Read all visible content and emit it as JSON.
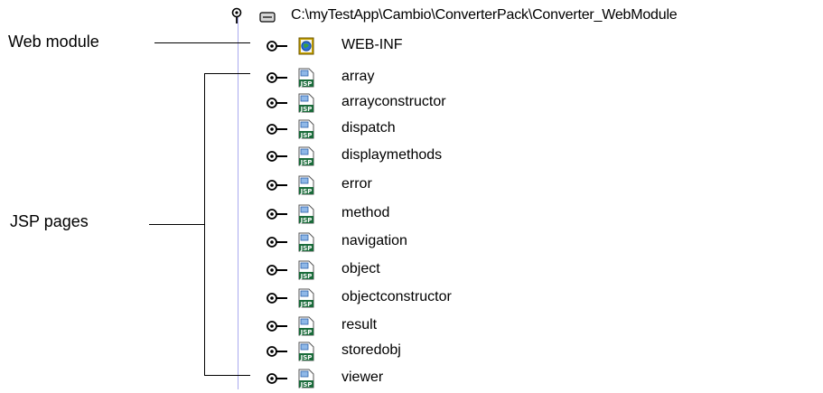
{
  "tree": {
    "root": {
      "path": "C:\\myTestApp\\Cambio\\ConverterPack\\Converter_WebModule",
      "expand_icon": "pin-handle-icon",
      "icon": "drive-icon"
    },
    "nodes": [
      {
        "label": "WEB-INF",
        "icon": "web-module-icon"
      },
      {
        "label": "array",
        "icon": "jsp-file-icon"
      },
      {
        "label": "arrayconstructor",
        "icon": "jsp-file-icon"
      },
      {
        "label": "dispatch",
        "icon": "jsp-file-icon"
      },
      {
        "label": "displaymethods",
        "icon": "jsp-file-icon"
      },
      {
        "label": "error",
        "icon": "jsp-file-icon"
      },
      {
        "label": "method",
        "icon": "jsp-file-icon"
      },
      {
        "label": "navigation",
        "icon": "jsp-file-icon"
      },
      {
        "label": "object",
        "icon": "jsp-file-icon"
      },
      {
        "label": "objectconstructor",
        "icon": "jsp-file-icon"
      },
      {
        "label": "result",
        "icon": "jsp-file-icon"
      },
      {
        "label": "storedobj",
        "icon": "jsp-file-icon"
      },
      {
        "label": "viewer",
        "icon": "jsp-file-icon"
      }
    ]
  },
  "callouts": {
    "web_module": "Web module",
    "jsp_pages": "JSP pages"
  },
  "colors": {
    "tree_line": "#aaaaee",
    "jsp_icon_badge": "#1a6b3a",
    "web_icon_frame": "#c8a400"
  }
}
